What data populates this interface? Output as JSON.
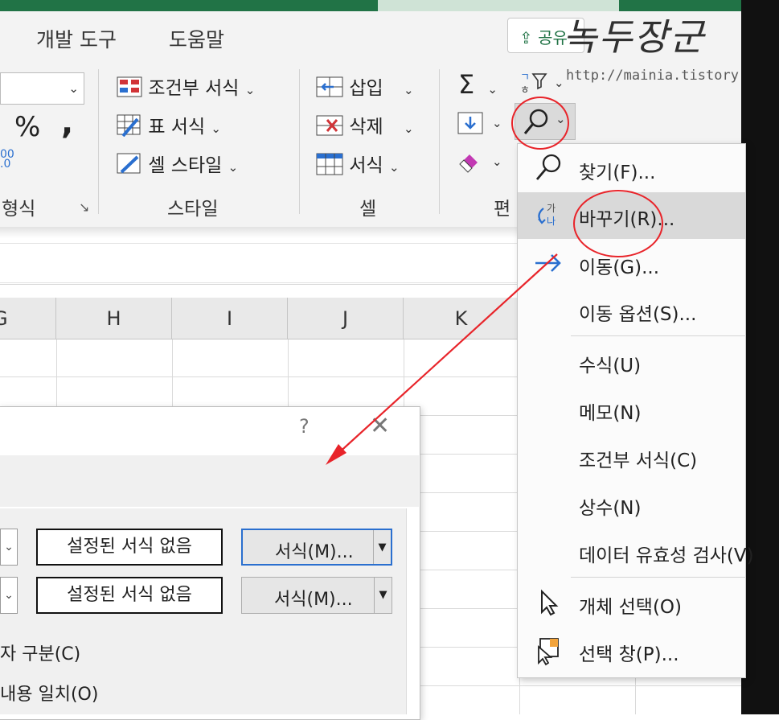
{
  "ribbon": {
    "tabs": [
      "개발 도구",
      "도움말"
    ],
    "share_label": "공유",
    "number": {
      "percent_symbol": "%",
      "comma_symbol": ",",
      "group_label": "형식"
    },
    "styles": {
      "conditional_formatting": "조건부 서식",
      "format_as_table": "표 서식",
      "cell_styles": "셀 스타일",
      "group_label": "스타일"
    },
    "cells": {
      "insert": "삽입",
      "delete": "삭제",
      "format": "서식",
      "group_label": "셀"
    },
    "editing": {
      "autosum_symbol": "Σ",
      "group_label": "편"
    }
  },
  "watermark": {
    "title": "녹두장군",
    "url": "http://mainia.tistory.com"
  },
  "grid": {
    "columns": [
      "G",
      "H",
      "I",
      "J",
      "K"
    ]
  },
  "dialog": {
    "help": "?",
    "close": "✕",
    "rows": [
      {
        "preview": "설정된 서식 없음",
        "format_button": "서식(M)..."
      },
      {
        "preview": "설정된 서식 없음",
        "format_button": "서식(M)..."
      }
    ],
    "options": [
      "자 구분(C)",
      "내용 일치(O)"
    ]
  },
  "find_select_menu": {
    "items": [
      {
        "label": "찾기(F)...",
        "icon": "magnifier-icon"
      },
      {
        "label": "바꾸기(R)...",
        "icon": "replace-icon",
        "highlighted": true
      },
      {
        "label": "이동(G)...",
        "icon": "arrow-right-icon"
      },
      {
        "label": "이동 옵션(S)..."
      },
      {
        "label": "수식(U)"
      },
      {
        "label": "메모(N)"
      },
      {
        "label": "조건부 서식(C)"
      },
      {
        "label": "상수(N)"
      },
      {
        "label": "데이터 유효성 검사(V)"
      },
      {
        "label": "개체 선택(O)",
        "icon": "pointer-icon"
      },
      {
        "label": "선택 창(P)...",
        "icon": "selection-pane-icon"
      }
    ],
    "replace_icon_text": {
      "top": "가",
      "bottom": "나"
    }
  },
  "colors": {
    "excel_green": "#217346",
    "annotation_red": "#e8242a",
    "focus_blue": "#2a6fcf"
  }
}
